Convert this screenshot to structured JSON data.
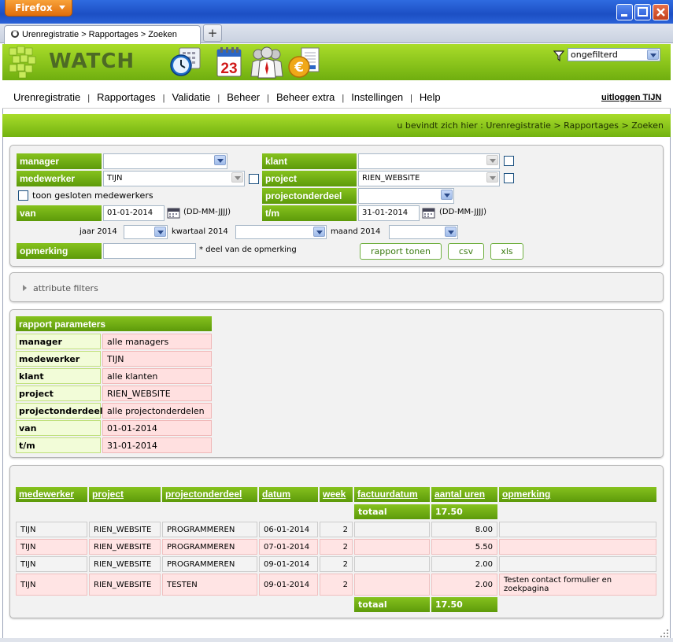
{
  "browser": {
    "app_button": "Firefox",
    "tab_title": "Urenregistratie > Rapportages > Zoeken",
    "new_tab": "+"
  },
  "header": {
    "logo_text": "WATCH",
    "icons": [
      "clock-calendar-icon",
      "calendar-23-icon",
      "users-icon",
      "euro-invoice-icon"
    ],
    "calendar_day": "23",
    "filter_value": "ongefilterd"
  },
  "menu": {
    "items": [
      "Urenregistratie",
      "Rapportages",
      "Validatie",
      "Beheer",
      "Beheer extra",
      "Instellingen",
      "Help"
    ],
    "separator": "|",
    "logout": "uitloggen TIJN"
  },
  "breadcrumb": "u bevindt zich hier : Urenregistratie > Rapportages > Zoeken",
  "search": {
    "manager_label": "manager",
    "manager_value": "",
    "medewerker_label": "medewerker",
    "medewerker_value": "TIJN",
    "show_closed_label": "toon gesloten medewerkers",
    "van_label": "van",
    "van_value": "01-01-2014",
    "date_format": "(DD-MM-JJJJ)",
    "klant_label": "klant",
    "klant_value": "",
    "project_label": "project",
    "project_value": "RIEN_WEBSITE",
    "projectonderdeel_label": "projectonderdeel",
    "projectonderdeel_value": "",
    "tm_label": "t/m",
    "tm_value": "31-01-2014",
    "jaar_label": "jaar 2014",
    "kwartaal_label": "kwartaal 2014",
    "maand_label": "maand 2014",
    "opmerking_label": "opmerking",
    "opmerking_value": "",
    "opmerking_hint": "* deel van de opmerking",
    "btn_report": "rapport tonen",
    "btn_csv": "csv",
    "btn_xls": "xls"
  },
  "attribute_filters": "attribute filters",
  "params": {
    "title": "rapport parameters",
    "rows": [
      {
        "label": "manager",
        "value": "alle managers"
      },
      {
        "label": "medewerker",
        "value": "TIJN"
      },
      {
        "label": "klant",
        "value": "alle klanten"
      },
      {
        "label": "project",
        "value": "RIEN_WEBSITE"
      },
      {
        "label": "projectonderdeel",
        "value": "alle projectonderdelen"
      },
      {
        "label": "van",
        "value": "01-01-2014"
      },
      {
        "label": "t/m",
        "value": "31-01-2014"
      }
    ]
  },
  "results": {
    "columns": [
      "medewerker",
      "project",
      "projectonderdeel",
      "datum",
      "week",
      "factuurdatum",
      "aantal uren",
      "opmerking"
    ],
    "total_label": "totaal",
    "total_value": "17.50",
    "rows": [
      {
        "medewerker": "TIJN",
        "project": "RIEN_WEBSITE",
        "onderdeel": "PROGRAMMEREN",
        "datum": "06-01-2014",
        "week": "2",
        "factuurdatum": "",
        "uren": "8.00",
        "opmerking": ""
      },
      {
        "medewerker": "TIJN",
        "project": "RIEN_WEBSITE",
        "onderdeel": "PROGRAMMEREN",
        "datum": "07-01-2014",
        "week": "2",
        "factuurdatum": "",
        "uren": "5.50",
        "opmerking": ""
      },
      {
        "medewerker": "TIJN",
        "project": "RIEN_WEBSITE",
        "onderdeel": "PROGRAMMEREN",
        "datum": "09-01-2014",
        "week": "2",
        "factuurdatum": "",
        "uren": "2.00",
        "opmerking": ""
      },
      {
        "medewerker": "TIJN",
        "project": "RIEN_WEBSITE",
        "onderdeel": "TESTEN",
        "datum": "09-01-2014",
        "week": "2",
        "factuurdatum": "",
        "uren": "2.00",
        "opmerking": "Testen contact formulier en zoekpagina"
      }
    ]
  }
}
